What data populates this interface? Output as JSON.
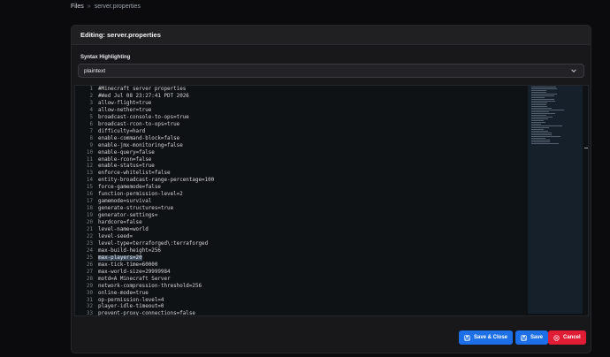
{
  "breadcrumb": {
    "root": "Files",
    "separator": "»",
    "file": "server.properties"
  },
  "modal": {
    "title": "Editing: server.properties",
    "syntax_label": "Syntax Highlighting",
    "syntax_value": "plaintext"
  },
  "editor": {
    "selected_line": 25,
    "selected_text": "max-players=20",
    "lines": [
      "#Minecraft server properties",
      "#Wed Jul 08 23:27:41 PDT 2026",
      "allow-flight=true",
      "allow-nether=true",
      "broadcast-console-to-ops=true",
      "broadcast-rcon-to-ops=true",
      "difficulty=hard",
      "enable-command-block=false",
      "enable-jmx-monitoring=false",
      "enable-query=false",
      "enable-rcon=false",
      "enable-status=true",
      "enforce-whitelist=false",
      "entity-broadcast-range-percentage=100",
      "force-gamemode=false",
      "function-permission-level=2",
      "gamemode=survival",
      "generate-structures=true",
      "generator-settings=",
      "hardcore=false",
      "level-name=world",
      "level-seed=",
      "level-type=terraforged\\:terraforged",
      "max-build-height=256",
      "max-players=20",
      "max-tick-time=60000",
      "max-world-size=29999984",
      "motd=A Minecraft Server",
      "network-compression-threshold=256",
      "online-mode=true",
      "op-permission-level=4",
      "player-idle-timeout=0",
      "prevent-proxy-connections=false"
    ]
  },
  "buttons": {
    "save_close": "Save & Close",
    "save": "Save",
    "cancel": "Cancel"
  },
  "colors": {
    "primary": "#1d6fe8",
    "danger": "#e11d36",
    "panel": "#18181b"
  }
}
